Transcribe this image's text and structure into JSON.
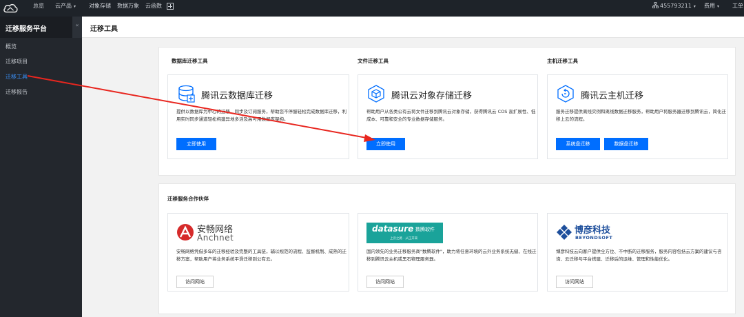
{
  "topbar": {
    "nav": [
      {
        "label": "总览",
        "caret": false
      },
      {
        "label": "云产品",
        "caret": true
      },
      {
        "label": "对象存储",
        "caret": false
      },
      {
        "label": "数据万象",
        "caret": false
      },
      {
        "label": "云函数",
        "caret": false
      }
    ],
    "account": "455793211",
    "billing": "费用",
    "ticket": "工单"
  },
  "sidebar": {
    "title": "迁移服务平台",
    "collapse_glyph": "«",
    "items": [
      {
        "label": "概览",
        "active": false
      },
      {
        "label": "迁移项目",
        "active": false
      },
      {
        "label": "迁移工具",
        "active": true
      },
      {
        "label": "迁移报告",
        "active": false
      }
    ]
  },
  "page": {
    "title": "迁移工具"
  },
  "tools": {
    "db": {
      "section": "数据库迁移工具",
      "name": "腾讯云数据库迁移",
      "desc": "提供以数据库为中心的迁移、同步及订阅服务，帮助您不停服轻松完成数据库迁移，利用实时同步通道轻松构建异地多活及高可用数据库架构。",
      "button": "立即使用"
    },
    "file": {
      "section": "文件迁移工具",
      "name": "腾讯云对象存储迁移",
      "desc": "帮助用户从各类公有云将文件迁移到腾讯云对象存储，获得腾讯云 COS 高扩展性、低成本、可靠和安全的专业数据存储服务。",
      "button": "立即使用"
    },
    "host": {
      "section": "主机迁移工具",
      "name": "腾讯云主机迁移",
      "desc": "服务迁移提供离线实例和离线数据迁移服务，帮助用户将服务器迁移到腾讯云，简化迁移上云的流程。",
      "button_system": "系统盘迁移",
      "button_data": "数据盘迁移"
    }
  },
  "partners": {
    "section": "迁移服务合作伙伴",
    "anchnet": {
      "logo_cn": "安畅网络",
      "logo_en": "Anchnet",
      "desc": "安畅网络凭借多年的迁移经验及完整的工具链，辅以规范的流程、监督机制、成熟的迁移方案，帮助用户将业务系统平滑迁移到公有云。",
      "button": "访问网站"
    },
    "datasure": {
      "logo_text": "datasure",
      "logo_cn": "数腾软件",
      "logo_sub": "上云之路 · 从正开来",
      "desc": "国内领先的业务迁移服务商\"数腾软件\"，助力将任意环境的云外业务系统无缝、在线迁移到腾讯云主机或黑石物理服务器。",
      "button": "访问网站"
    },
    "beyondsoft": {
      "logo_cn": "博彦科技",
      "logo_en": "BEYONDSOFT",
      "desc": "博彦科技云向客户提供全方位、不中断的迁移服务，服务内容包括云方案的建议与咨询、云迁移与平台搭建、迁移后的运维、管理和性能优化。",
      "button": "访问网站"
    }
  },
  "colors": {
    "primary": "#006eff",
    "active_nav": "#3b8ff5",
    "annotation_arrow": "#e8261f",
    "datasure_bg": "#1aa39a",
    "anchnet_red": "#d62b2b",
    "beyondsoft_blue": "#1e4f9c"
  }
}
